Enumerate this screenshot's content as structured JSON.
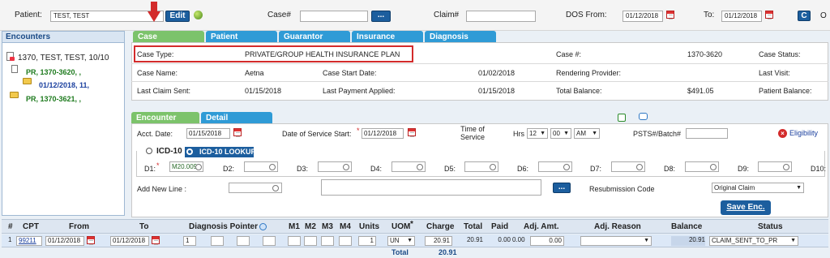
{
  "topbar": {
    "patient_label": "Patient:",
    "patient_value": "TEST, TEST",
    "edit_button": "Edit",
    "case_label": "Case#",
    "case_value": "",
    "case_lookup_button": "...",
    "claim_label": "Claim#",
    "claim_value": "",
    "dos_from_label": "DOS From:",
    "dos_from_value": "01/12/2018",
    "to_label": "To:",
    "to_value": "01/12/2018",
    "c_button": "C",
    "o_label": "O"
  },
  "sidebar": {
    "title": "Encounters",
    "items": [
      {
        "label": "1370, TEST, TEST, 10/10"
      },
      {
        "label": "PR, 1370-3620, ,"
      },
      {
        "label": "01/12/2018, 11,"
      },
      {
        "label": "PR, 1370-3621, ,"
      }
    ]
  },
  "case_tabs": [
    "Case",
    "Patient",
    "Guarantor",
    "Insurance",
    "Diagnosis"
  ],
  "case_info": {
    "case_type_label": "Case Type:",
    "case_type_value": "PRIVATE/GROUP HEALTH INSURANCE PLAN",
    "case_no_label": "Case #:",
    "case_no_value": "1370-3620",
    "case_status_label": "Case Status:",
    "case_name_label": "Case Name:",
    "case_name_value": "Aetna",
    "case_start_label": "Case Start Date:",
    "case_start_value": "01/02/2018",
    "rendering_provider_label": "Rendering Provider:",
    "last_visit_label": "Last Visit:",
    "last_claim_label": "Last Claim Sent:",
    "last_claim_value": "01/15/2018",
    "last_payment_label": "Last Payment Applied:",
    "last_payment_value": "01/15/2018",
    "total_balance_label": "Total Balance:",
    "total_balance_value": "$491.05",
    "patient_balance_label": "Patient Balance:"
  },
  "enc_tabs": [
    "Encounter",
    "Detail"
  ],
  "encounter": {
    "acct_date_label": "Acct. Date:",
    "acct_date_value": "01/15/2018",
    "dos_start_label": "Date of Service Start:",
    "dos_start_value": "01/12/2018",
    "time_of_service_label": "Time of Service",
    "hrs_label": "Hrs",
    "hrs_value": "12",
    "min_value": "00",
    "ampm_value": "AM",
    "psts_label": "PSTS#/Batch#",
    "eligibility_label": "Eligibility",
    "icd_label": "ICD-10",
    "icd_lookup_button": "ICD-10 LOOKUP",
    "diag_labels": [
      "D1:",
      "D2:",
      "D3:",
      "D4:",
      "D5:",
      "D6:",
      "D7:",
      "D8:",
      "D9:",
      "D10:"
    ],
    "d1_value": "M20.009",
    "add_new_line_label": "Add New Line :",
    "add_line_button": "...",
    "resubmission_label": "Resubmission Code",
    "resubmission_value": "Original Claim",
    "save_button": "Save Enc."
  },
  "grid": {
    "headers": [
      "#",
      "CPT",
      "From",
      "To",
      "Diagnosis Pointer",
      "M1",
      "M2",
      "M3",
      "M4",
      "Units",
      "UOM",
      "Charge",
      "Total",
      "Paid",
      "Adj. Amt.",
      "Adj. Reason",
      "Balance",
      "Status"
    ],
    "row": {
      "num": "1",
      "cpt": "99211",
      "from": "01/12/2018",
      "to": "01/12/2018",
      "pointer1": "1",
      "units": "1",
      "uom": "UN",
      "charge": "20.91",
      "total": "20.91",
      "paid": "0.00",
      "adj_amt1": "0.00",
      "adj_amt2": "0.00",
      "balance": "20.91",
      "status": "CLAIM_SENT_TO_PR"
    },
    "total_label": "Total",
    "total_value": "20.91"
  }
}
